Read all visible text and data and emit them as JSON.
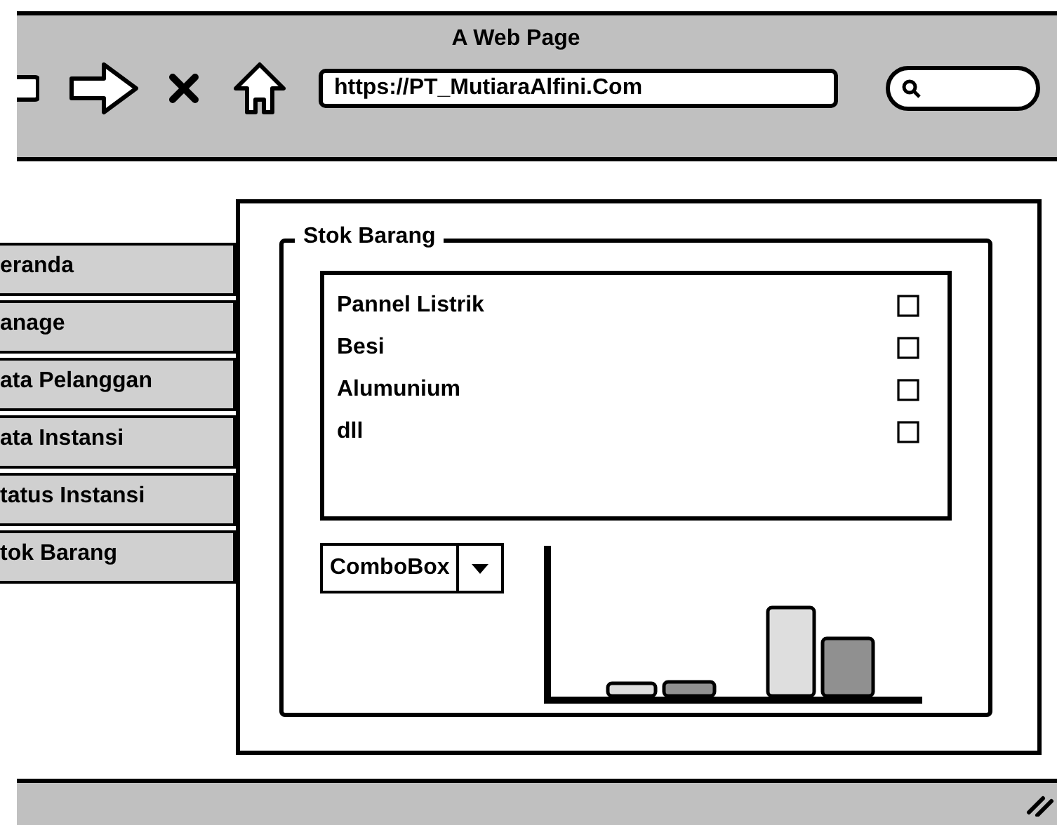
{
  "window": {
    "title": "A Web Page"
  },
  "browser": {
    "url": "https://PT_MutiaraAlfini.Com"
  },
  "sidebar": {
    "items": [
      {
        "label": "eranda"
      },
      {
        "label": "anage"
      },
      {
        "label": "ata Pelanggan"
      },
      {
        "label": "ata Instansi"
      },
      {
        "label": "tatus Instansi"
      },
      {
        "label": "tok Barang"
      }
    ]
  },
  "panel": {
    "title": "Stok Barang",
    "items": [
      {
        "label": "Pannel Listrik",
        "checked": false
      },
      {
        "label": "Besi",
        "checked": false
      },
      {
        "label": "Alumunium",
        "checked": false
      },
      {
        "label": "dll",
        "checked": false
      }
    ],
    "combobox": {
      "value": "ComboBox"
    }
  }
}
